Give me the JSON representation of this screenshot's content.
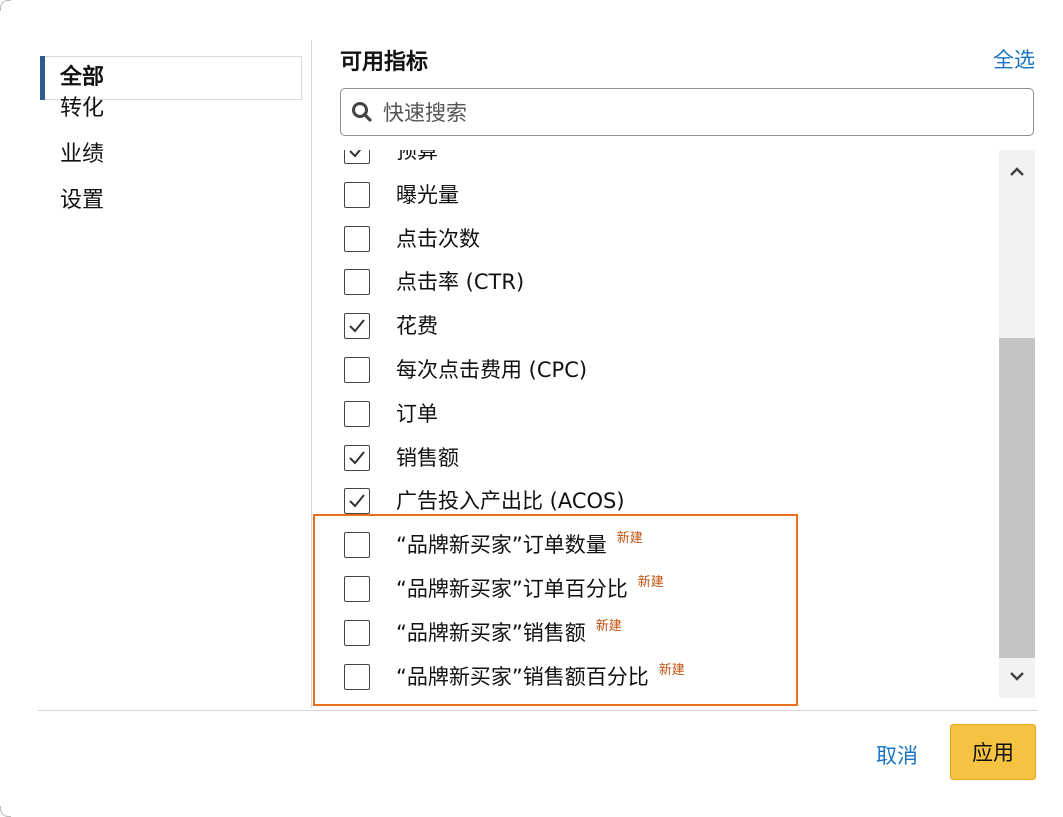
{
  "sidebar": {
    "items": [
      {
        "label": "全部",
        "active": true
      },
      {
        "label": "转化",
        "active": false
      },
      {
        "label": "业绩",
        "active": false
      },
      {
        "label": "设置",
        "active": false
      }
    ]
  },
  "panel": {
    "title": "可用指标",
    "select_all": "全选"
  },
  "search": {
    "placeholder": "快速搜索",
    "value": ""
  },
  "metrics": [
    {
      "label": "预算",
      "checked": true,
      "badge": ""
    },
    {
      "label": "曝光量",
      "checked": false,
      "badge": ""
    },
    {
      "label": "点击次数",
      "checked": false,
      "badge": ""
    },
    {
      "label": "点击率 (CTR)",
      "checked": false,
      "badge": ""
    },
    {
      "label": "花费",
      "checked": true,
      "badge": ""
    },
    {
      "label": "每次点击费用 (CPC)",
      "checked": false,
      "badge": ""
    },
    {
      "label": "订单",
      "checked": false,
      "badge": ""
    },
    {
      "label": "销售额",
      "checked": true,
      "badge": ""
    },
    {
      "label": "广告投入产出比 (ACOS)",
      "checked": true,
      "badge": ""
    },
    {
      "label": "“品牌新买家”订单数量",
      "checked": false,
      "badge": "新建"
    },
    {
      "label": "“品牌新买家”订单百分比",
      "checked": false,
      "badge": "新建"
    },
    {
      "label": "“品牌新买家”销售额",
      "checked": false,
      "badge": "新建"
    },
    {
      "label": "“品牌新买家”销售额百分比",
      "checked": false,
      "badge": "新建"
    }
  ],
  "footer": {
    "cancel_label": "取消",
    "apply_label": "应用"
  },
  "colors": {
    "accent": "#1a73c2",
    "apply_button": "#f5c242",
    "highlight_border": "#e8701a",
    "new_badge": "#c0510e",
    "active_indicator": "#2f5d8a"
  },
  "icons": {
    "search": "search-icon",
    "scroll_up": "chevron-up-icon",
    "scroll_down": "chevron-down-icon",
    "check": "check-icon"
  }
}
